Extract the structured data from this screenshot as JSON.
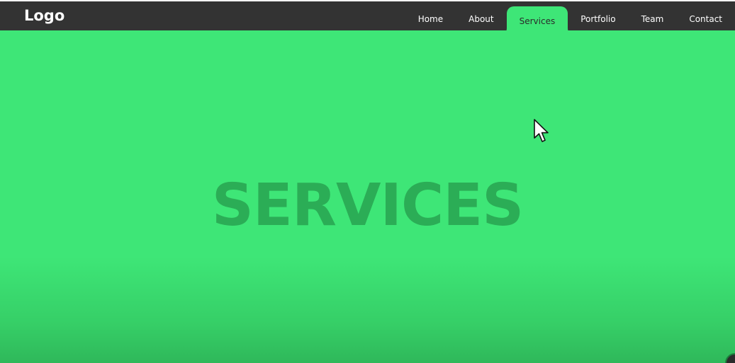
{
  "header": {
    "logo": "Logo",
    "nav": [
      {
        "label": "Home",
        "active": false
      },
      {
        "label": "About",
        "active": false
      },
      {
        "label": "Services",
        "active": true
      },
      {
        "label": "Portfolio",
        "active": false
      },
      {
        "label": "Team",
        "active": false
      },
      {
        "label": "Contact",
        "active": false
      }
    ]
  },
  "hero": {
    "title": "SERVICES"
  },
  "colors": {
    "navbar_bg": "#333333",
    "accent_green": "#3ee677",
    "title_green": "#2aa753"
  },
  "icons": {
    "cursor": "mouse-pointer-icon",
    "corner": "circular-badge-icon"
  }
}
